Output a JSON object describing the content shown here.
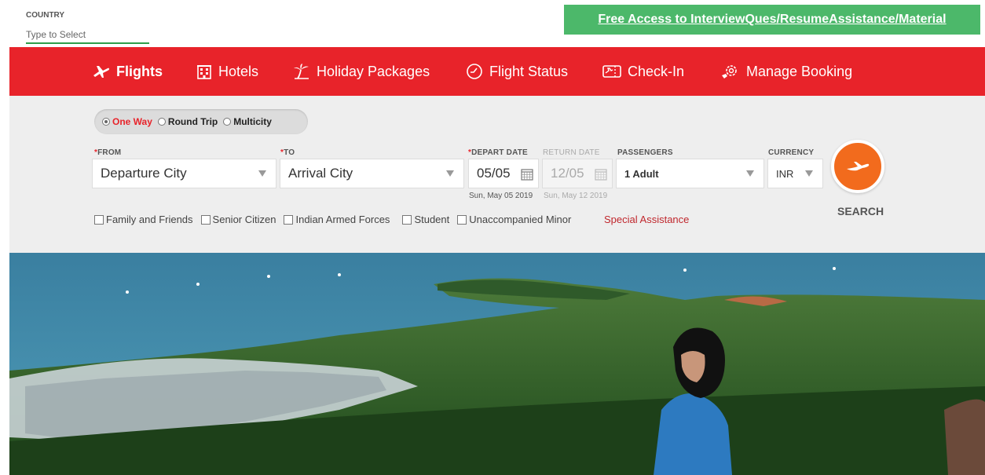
{
  "country": {
    "label": "COUNTRY",
    "placeholder": "Type to Select"
  },
  "promo": {
    "text": "Free Access to InterviewQues/ResumeAssistance/Material"
  },
  "nav": {
    "items": [
      {
        "label": "Flights",
        "icon": "plane-icon"
      },
      {
        "label": "Hotels",
        "icon": "hotel-icon"
      },
      {
        "label": "Holiday Packages",
        "icon": "palm-tree-icon"
      },
      {
        "label": "Flight Status",
        "icon": "clock-icon"
      },
      {
        "label": "Check-In",
        "icon": "boarding-pass-icon"
      },
      {
        "label": "Manage Booking",
        "icon": "settings-gear-icon"
      }
    ]
  },
  "trip": {
    "one_way": "One Way",
    "round_trip": "Round Trip",
    "multicity": "Multicity",
    "selected": "One Way"
  },
  "form": {
    "from": {
      "label": "FROM",
      "value": "Departure City"
    },
    "to": {
      "label": "TO",
      "value": "Arrival City"
    },
    "depart": {
      "label": "DEPART DATE",
      "value": "05/05",
      "sub": "Sun, May 05 2019"
    },
    "return": {
      "label": "RETURN DATE",
      "value": "12/05",
      "sub": "Sun, May 12 2019"
    },
    "passengers": {
      "label": "PASSENGERS",
      "value": "1 Adult"
    },
    "currency": {
      "label": "CURRENCY",
      "value": "INR"
    },
    "search_label": "SEARCH"
  },
  "options": {
    "family": "Family and Friends",
    "senior": "Senior Citizen",
    "armed": "Indian Armed Forces",
    "student": "Student",
    "minor": "Unaccompanied Minor",
    "special": "Special Assistance"
  },
  "colors": {
    "brand_red": "#e8232a",
    "promo_green": "#4cb86a",
    "search_orange": "#f26b1d"
  }
}
